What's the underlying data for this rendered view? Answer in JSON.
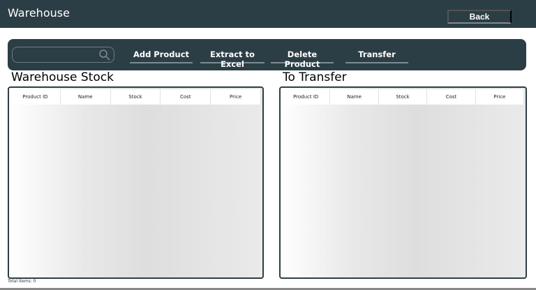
{
  "header": {
    "title": "Warehouse",
    "back_label": "Back"
  },
  "toolbar": {
    "search_placeholder": "",
    "add": "Add Product",
    "extract": "Extract to Excel",
    "delete": "Delete Product",
    "transfer": "Transfer"
  },
  "left": {
    "title": "Warehouse Stock",
    "columns": [
      "Product ID",
      "Name",
      "Stock",
      "Cost",
      "Price"
    ]
  },
  "right": {
    "title": "To Transfer",
    "columns": [
      "Product ID",
      "Name",
      "Stock",
      "Cost",
      "Price"
    ]
  },
  "footer": {
    "total": "Total Items: 0"
  }
}
